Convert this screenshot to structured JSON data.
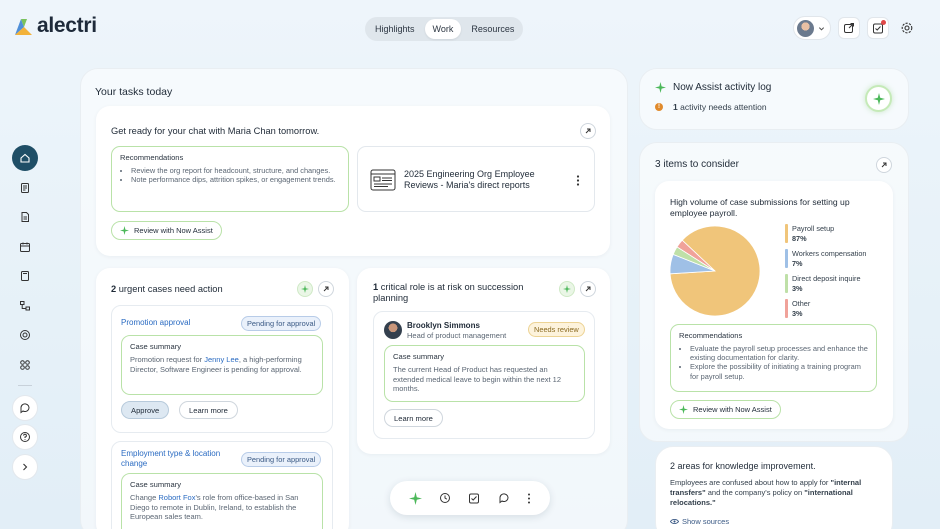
{
  "app": {
    "name": "alectri"
  },
  "topnav": {
    "tabs": [
      {
        "label": "Highlights"
      },
      {
        "label": "Work"
      },
      {
        "label": "Resources"
      }
    ],
    "active": "Work"
  },
  "tasks": {
    "heading": "Your tasks today",
    "chat_card": {
      "title": "Get ready for your chat with Maria Chan tomorrow.",
      "rec_label": "Recommendations",
      "rec_items": [
        "Review the org report for headcount, structure, and changes.",
        "Note performance dips, attrition spikes, or engagement trends."
      ],
      "doc_title": "2025 Engineering Org Employee Reviews  - Maria's direct reports",
      "review_btn": "Review with Now Assist"
    },
    "urgent": {
      "count": "2",
      "label": "urgent cases need action",
      "case1": {
        "title": "Promotion approval",
        "badge": "Pending for approval",
        "summary_label": "Case summary",
        "summary_pre": "Promotion request for ",
        "summary_link": "Jenny Lee",
        "summary_post": ", a high-performing Director, Software Engineer is pending for approval.",
        "approve_btn": "Approve",
        "learn_btn": "Learn more"
      },
      "case2": {
        "title": "Employment type & location change",
        "badge": "Pending for approval",
        "summary_label": "Case summary",
        "summary_pre": "Change ",
        "summary_link": "Robort Fox",
        "summary_post": "'s role from office-based in San Diego to remote in Dublin, Ireland, to establish the European sales team."
      }
    },
    "critical": {
      "count": "1",
      "label": "critical role is at risk on succession planning",
      "person_name": "Brooklyn Simmons",
      "person_title": "Head of product management",
      "badge": "Needs review",
      "summary_label": "Case summary",
      "summary_text": "The current Head of Product has requested an extended medical leave to begin within the next 12 months.",
      "learn_btn": "Learn more"
    }
  },
  "activity": {
    "title": "Now Assist activity log",
    "count": "1",
    "text": "activity needs attention"
  },
  "consider": {
    "count": "3",
    "label": "items to consider",
    "insight": "High volume of case submissions for setting up employee payroll.",
    "rec_label": "Recommendations",
    "rec_items": [
      "Evaluate the payroll setup processes and enhance the existing documentation for clarity.",
      "Explore the possibility of initiating a training program for payroll setup."
    ],
    "review_btn": "Review with Now Assist"
  },
  "knowledge": {
    "title": "2 areas for knowledge improvement.",
    "text_pre": "Employees are confused about how to apply for ",
    "bold1": "\"internal transfers\"",
    "text_mid": " and the company's policy on ",
    "bold2": "\"international relocations.\"",
    "sources_btn": "Show sources"
  },
  "chart_data": {
    "type": "pie",
    "categories": [
      "Payroll setup",
      "Workers compensation",
      "Direct deposit inquire",
      "Other"
    ],
    "values": [
      87,
      7,
      3,
      3
    ],
    "labels": [
      "87%",
      "7%",
      "3%",
      "3%"
    ],
    "colors": [
      "#f0c57a",
      "#9fc0e6",
      "#bfe0a8",
      "#f0a29a"
    ],
    "legend": "right"
  }
}
